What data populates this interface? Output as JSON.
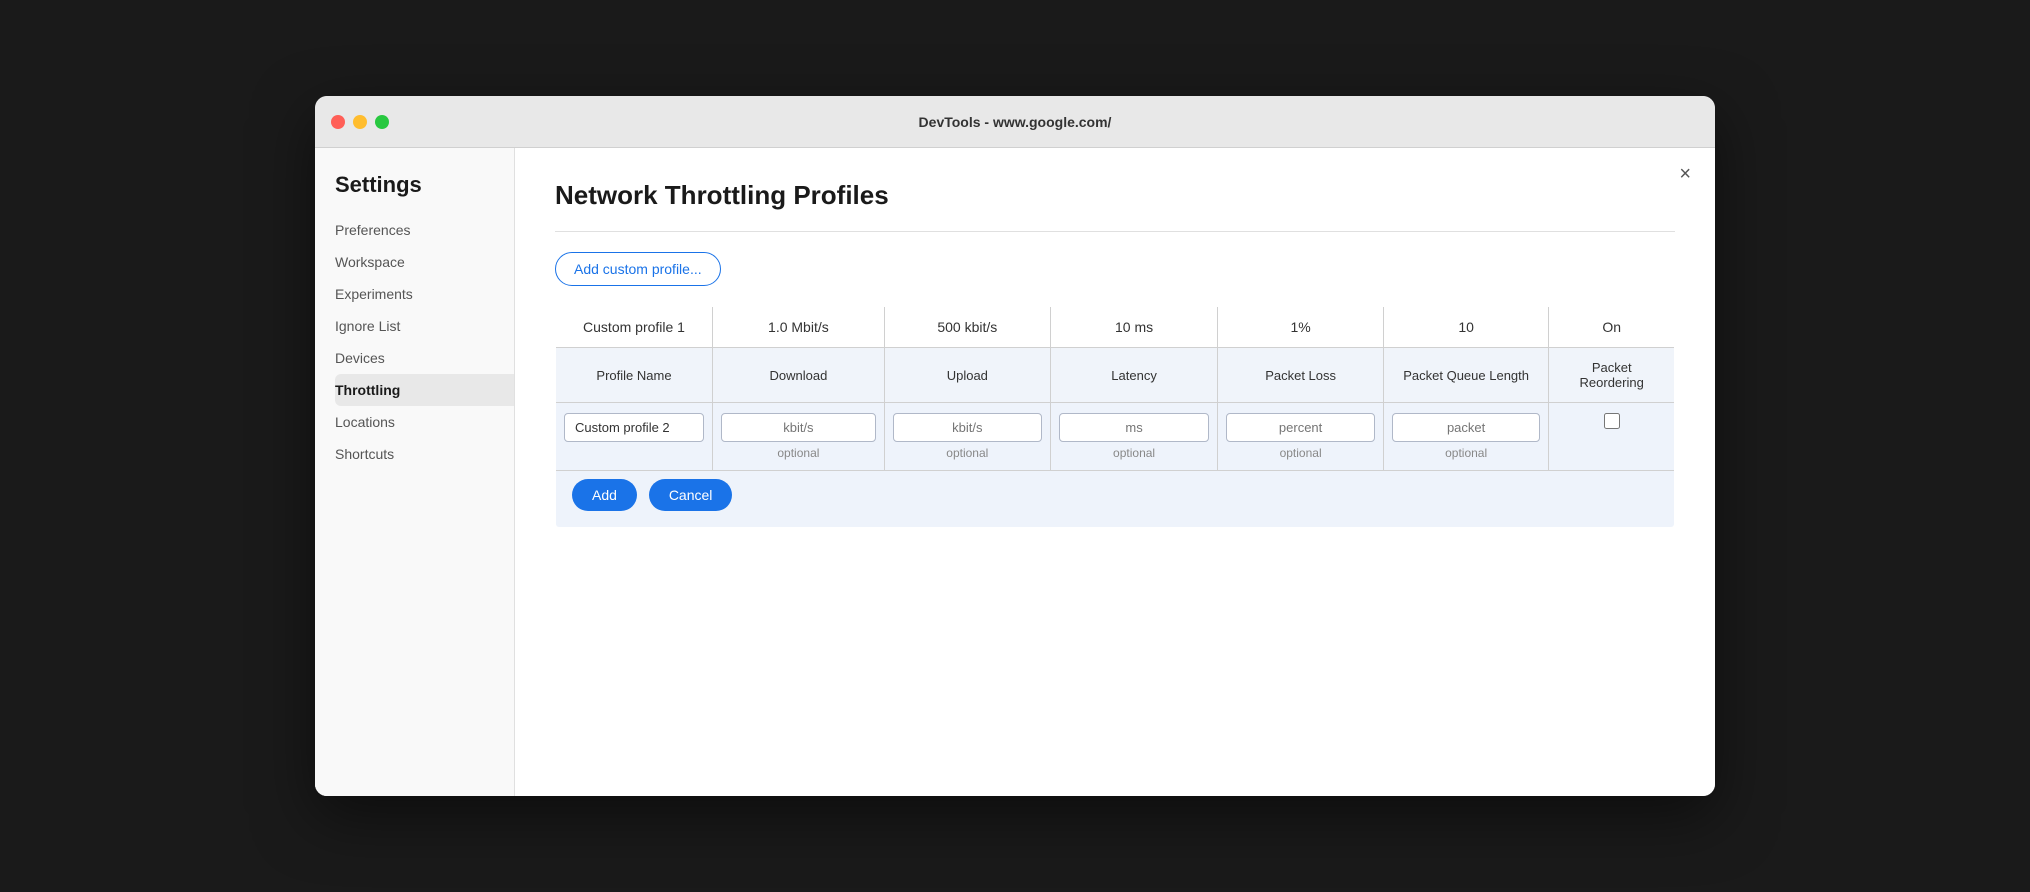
{
  "window": {
    "title": "DevTools - www.google.com/"
  },
  "sidebar": {
    "title": "Settings",
    "items": [
      {
        "label": "Preferences",
        "active": false
      },
      {
        "label": "Workspace",
        "active": false
      },
      {
        "label": "Experiments",
        "active": false
      },
      {
        "label": "Ignore List",
        "active": false
      },
      {
        "label": "Devices",
        "active": false
      },
      {
        "label": "Throttling",
        "active": true
      },
      {
        "label": "Locations",
        "active": false
      },
      {
        "label": "Shortcuts",
        "active": false
      }
    ]
  },
  "main": {
    "title": "Network Throttling Profiles",
    "add_button_label": "Add custom profile...",
    "close_label": "×",
    "table": {
      "existing_row": {
        "name": "Custom profile 1",
        "download": "1.0 Mbit/s",
        "upload": "500 kbit/s",
        "latency": "10 ms",
        "packet_loss": "1%",
        "packet_queue": "10",
        "packet_reordering": "On"
      },
      "headers": {
        "profile_name": "Profile Name",
        "download": "Download",
        "upload": "Upload",
        "latency": "Latency",
        "packet_loss": "Packet Loss",
        "packet_queue": "Packet Queue Length",
        "packet_reordering": "Packet Reordering"
      },
      "input_row": {
        "name_value": "Custom profile 2",
        "name_placeholder": "",
        "download_placeholder": "kbit/s",
        "download_hint": "optional",
        "upload_placeholder": "kbit/s",
        "upload_hint": "optional",
        "latency_placeholder": "ms",
        "latency_hint": "optional",
        "packet_loss_placeholder": "percent",
        "packet_loss_hint": "optional",
        "packet_queue_placeholder": "packet",
        "packet_queue_hint": "optional"
      },
      "actions": {
        "add_label": "Add",
        "cancel_label": "Cancel"
      }
    }
  }
}
